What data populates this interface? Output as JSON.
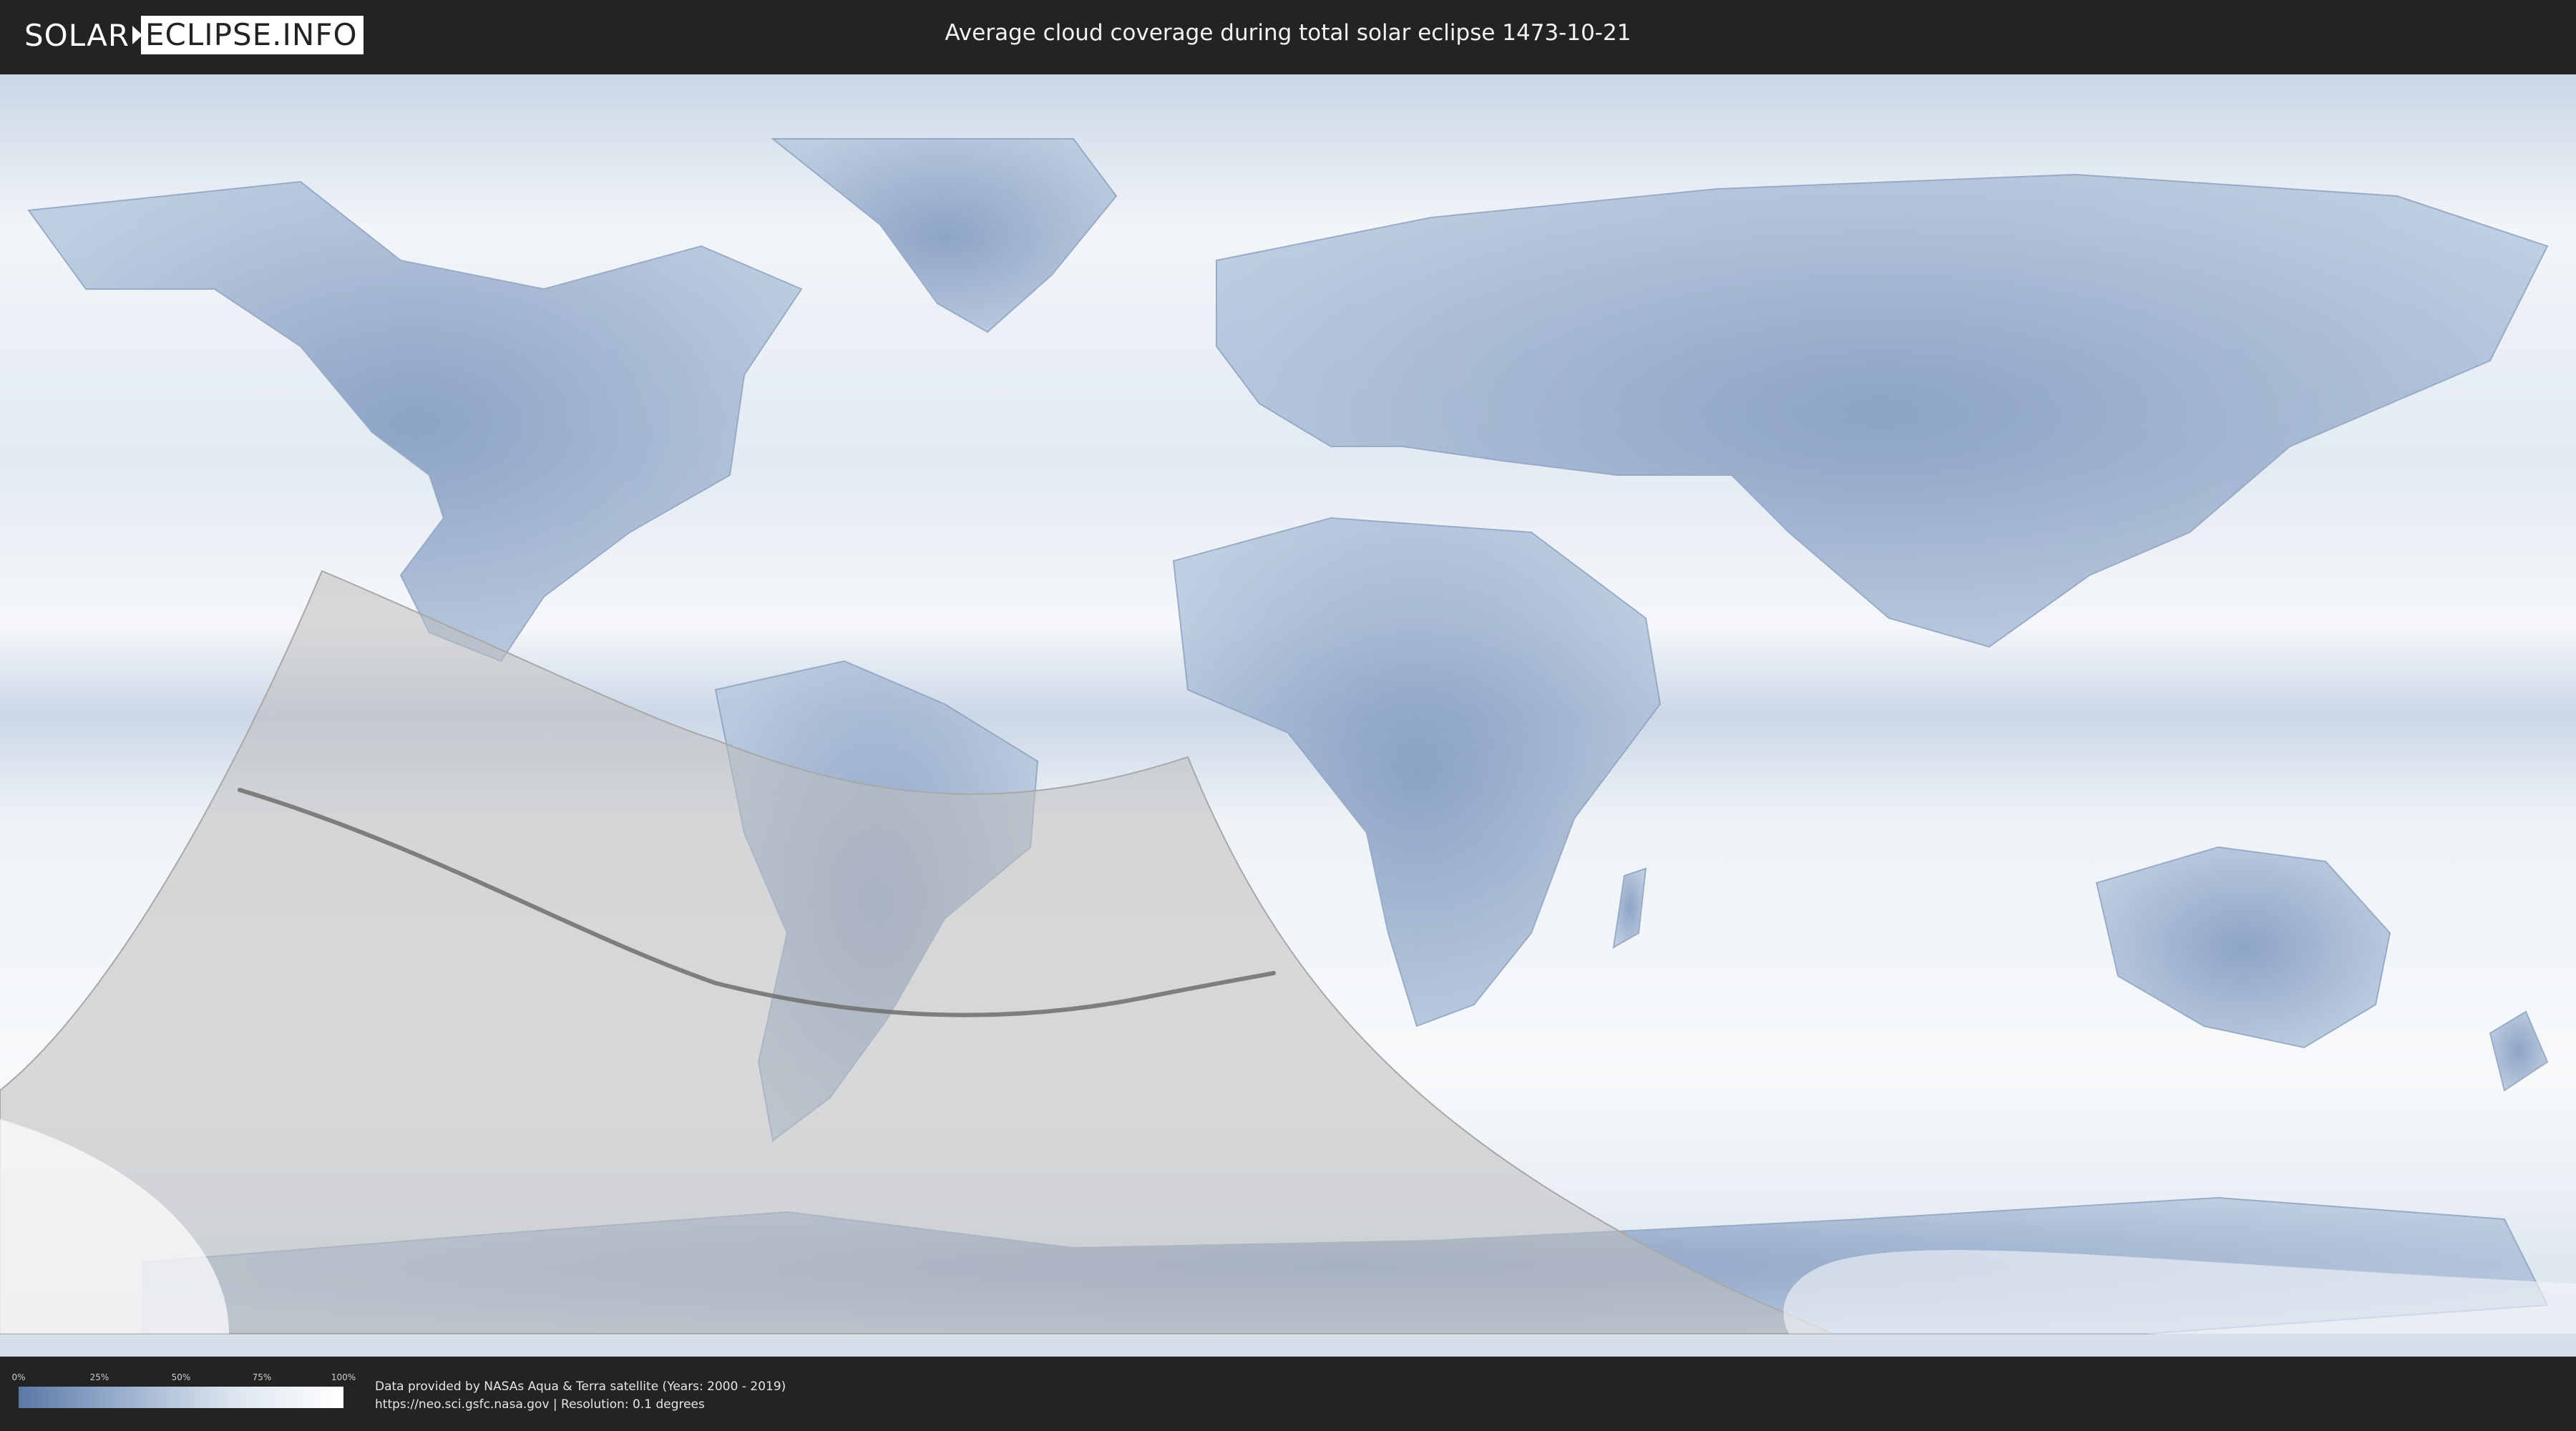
{
  "header": {
    "logo_left": "SOLAR",
    "logo_right": "ECLIPSE.INFO",
    "title": "Average cloud coverage during total solar eclipse 1473-10-21"
  },
  "legend": {
    "ticks": [
      "0%",
      "25%",
      "50%",
      "75%",
      "100%"
    ],
    "colors": [
      "#5a78a6",
      "#9db2cf",
      "#dde6f0",
      "#ffffff"
    ]
  },
  "footer": {
    "line1": "Data provided by NASAs Aqua & Terra satellite (Years: 2000 - 2019)",
    "line2": "https://neo.sci.gsfc.nasa.gov | Resolution: 0.1 degrees"
  },
  "colors": {
    "background": "#232323",
    "ocean_cloud": "#e8eef5",
    "land_clear": "#7f98bd",
    "eclipse_shadow": "#b8b8b8",
    "central_line": "#6e6e6e"
  }
}
